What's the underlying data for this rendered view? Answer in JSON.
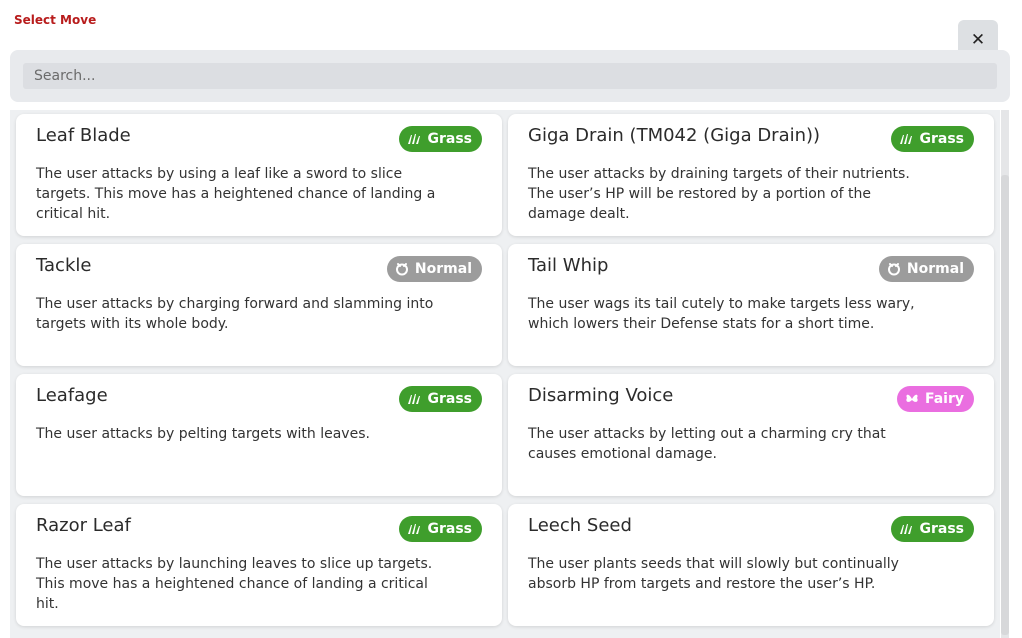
{
  "dialog": {
    "title": "Select Move",
    "close_label": "✕"
  },
  "search": {
    "placeholder": "Search..."
  },
  "types": {
    "Grass": {
      "color": "#3f9e2c",
      "icon": "grass-icon"
    },
    "Normal": {
      "color": "#9c9c9c",
      "icon": "normal-icon"
    },
    "Fairy": {
      "color": "#ea6ee0",
      "icon": "fairy-icon"
    }
  },
  "moves": [
    {
      "name": "Leaf Blade",
      "type": "Grass",
      "description": "The user attacks by using a leaf like a sword to slice targets. This move has a heightened chance of landing a critical hit."
    },
    {
      "name": "Giga Drain (TM042 (Giga Drain))",
      "type": "Grass",
      "description": "The user attacks by draining targets of their nutrients. The user’s HP will be restored by a portion of the damage dealt."
    },
    {
      "name": "Tackle",
      "type": "Normal",
      "description": "The user attacks by charging forward and slamming into targets with its whole body."
    },
    {
      "name": "Tail Whip",
      "type": "Normal",
      "description": "The user wags its tail cutely to make targets less wary, which lowers their Defense stats for a short time."
    },
    {
      "name": "Leafage",
      "type": "Grass",
      "description": "The user attacks by pelting targets with leaves."
    },
    {
      "name": "Disarming Voice",
      "type": "Fairy",
      "description": "The user attacks by letting out a charming cry that causes emotional damage."
    },
    {
      "name": "Razor Leaf",
      "type": "Grass",
      "description": "The user attacks by launching leaves to slice up targets. This move has a heightened chance of landing a critical hit."
    },
    {
      "name": "Leech Seed",
      "type": "Grass",
      "description": "The user plants seeds that will slowly but continually absorb HP from targets and restore the user’s HP."
    }
  ]
}
